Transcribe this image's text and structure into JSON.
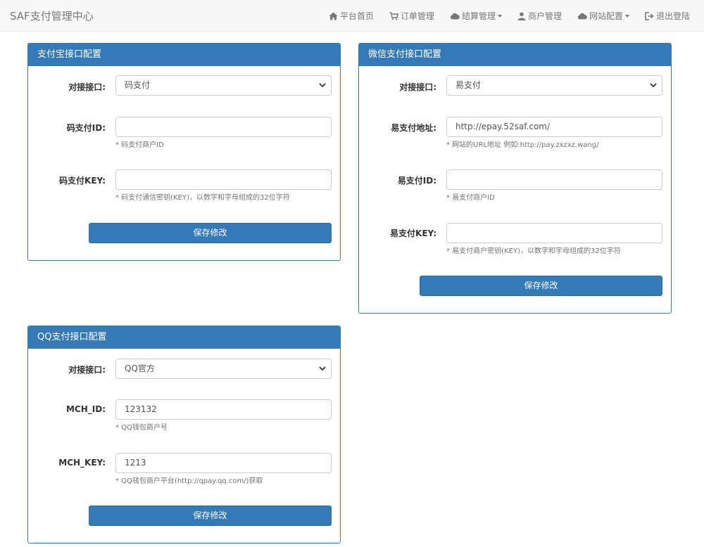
{
  "navbar": {
    "brand": "SAF支付管理中心",
    "items": [
      {
        "label": "平台首页",
        "icon": "home-icon"
      },
      {
        "label": "订单管理",
        "icon": "cart-icon"
      },
      {
        "label": "结算管理",
        "icon": "cloud-icon",
        "dropdown": true
      },
      {
        "label": "商户管理",
        "icon": "user-icon"
      },
      {
        "label": "网站配置",
        "icon": "cloud-icon",
        "dropdown": true
      },
      {
        "label": "退出登陆",
        "icon": "logout-icon"
      }
    ]
  },
  "alipay": {
    "title": "支付宝接口配置",
    "interface_label": "对接接口:",
    "interface_value": "码支付",
    "id_label": "码支付ID:",
    "id_value": "",
    "id_help": "* 码支付商户ID",
    "key_label": "码支付KEY:",
    "key_value": "",
    "key_help": "* 码支付通信密钥(KEY)，以数字和字母组成的32位字符",
    "save_label": "保存修改"
  },
  "wechat": {
    "title": "微信支付接口配置",
    "interface_label": "对接接口:",
    "interface_value": "易支付",
    "url_label": "易支付地址:",
    "url_value": "http://epay.52saf.com/",
    "url_help": "* 网站的URL地址 例如:http://pay.zxzxz.wang/",
    "id_label": "易支付ID:",
    "id_value": "",
    "id_help": "* 易支付商户ID",
    "key_label": "易支付KEY:",
    "key_value": "",
    "key_help": "* 易支付商户密钥(KEY)，以数字和字母组成的32位字符",
    "save_label": "保存修改"
  },
  "qq": {
    "title": "QQ支付接口配置",
    "interface_label": "对接接口:",
    "interface_value": "QQ官方",
    "mch_id_label": "MCH_ID:",
    "mch_id_value": "123132",
    "mch_id_help": "* QQ钱包商户号",
    "mch_key_label": "MCH_KEY:",
    "mch_key_value": "1213",
    "mch_key_help": "* QQ钱包商户平台(http://qpay.qq.com/)获取",
    "save_label": "保存修改"
  },
  "colors": {
    "primary": "#337ab7",
    "navbar_bg": "#f8f8f8",
    "navbar_text": "#777777"
  }
}
